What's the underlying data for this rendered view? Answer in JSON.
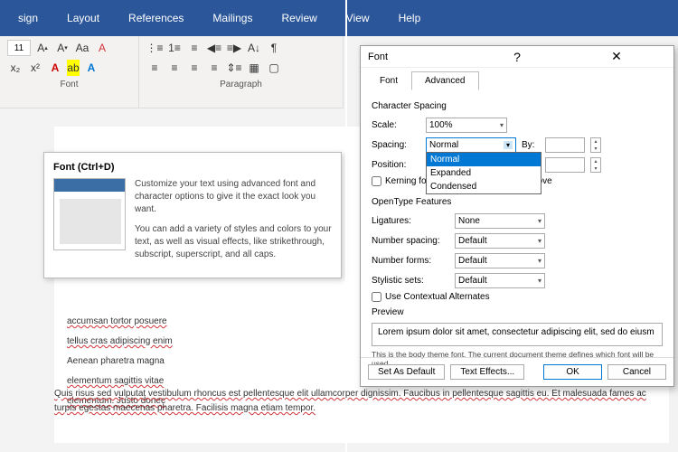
{
  "ribbon": {
    "menu": [
      "sign",
      "Layout",
      "References",
      "Mailings",
      "Review",
      "View",
      "Help"
    ]
  },
  "toolbar": {
    "font_size": "11",
    "group_font_label": "Font",
    "group_para_label": "Paragraph"
  },
  "tooltip": {
    "title": "Font (Ctrl+D)",
    "para1": "Customize your text using advanced font and character options to give it the exact look you want.",
    "para2": "You can add a variety of styles and colors to your text, as well as visual effects, like strikethrough, subscript, superscript, and all caps."
  },
  "doc": {
    "p1a": "accumsan tortor posuere",
    "p1b": "tellus cras adipiscing enim",
    "p1c": "Aenean pharetra magna",
    "p1d": "elementum sagittis vitae",
    "p1e": "elementum. Justo donec",
    "p2": "Quis risus sed vulputat vestibulum rhoncus est pellentesque elit ullamcorper dignissim. Faucibus in pellentesque sagittis eu. Et malesuada fames ac turpis egestas maecenas pharetra. Facilisis magna etiam tempor."
  },
  "dialog": {
    "title": "Font",
    "tabs": {
      "font": "Font",
      "advanced": "Advanced"
    },
    "char_spacing": {
      "section": "Character Spacing",
      "scale_label": "Scale:",
      "scale_value": "100%",
      "spacing_label": "Spacing:",
      "spacing_value": "Normal",
      "spacing_options": [
        "Normal",
        "Expanded",
        "Condensed"
      ],
      "position_label": "Position:",
      "by_label": "By:",
      "kerning_label": "Kerning for fonts",
      "kerning_after": "Points and above"
    },
    "opentype": {
      "section": "OpenType Features",
      "ligatures_label": "Ligatures:",
      "ligatures_value": "None",
      "numspacing_label": "Number spacing:",
      "numspacing_value": "Default",
      "numforms_label": "Number forms:",
      "numforms_value": "Default",
      "stylistic_label": "Stylistic sets:",
      "stylistic_value": "Default",
      "contextual_label": "Use Contextual Alternates"
    },
    "preview": {
      "section": "Preview",
      "text": "Lorem ipsum dolor sit amet, consectetur adipiscing elit, sed do eiusm",
      "note": "This is the body theme font. The current document theme defines which font will be used."
    },
    "buttons": {
      "set_default": "Set As Default",
      "text_effects": "Text Effects...",
      "ok": "OK",
      "cancel": "Cancel"
    }
  }
}
